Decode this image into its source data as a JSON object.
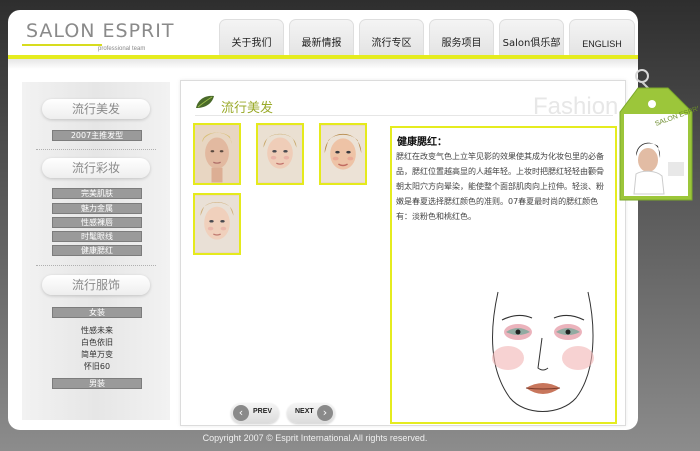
{
  "header": {
    "logo_text": "SALON ESPRIT",
    "logo_sub": "professional team",
    "nav": [
      {
        "label": "关于我们"
      },
      {
        "label": "最新情报"
      },
      {
        "label": "流行专区"
      },
      {
        "label": "服务项目"
      },
      {
        "label": "Salon俱乐部"
      },
      {
        "label": "ENGLISH"
      }
    ]
  },
  "sidebar": {
    "sections": [
      {
        "title": "流行美发",
        "items": [
          {
            "label": "2007主推发型",
            "style": "button"
          }
        ]
      },
      {
        "title": "流行彩妆",
        "items": [
          {
            "label": "完美肌肤",
            "style": "button"
          },
          {
            "label": "魅力金属",
            "style": "button"
          },
          {
            "label": "性感裸唇",
            "style": "button"
          },
          {
            "label": "时髦眼线",
            "style": "button"
          },
          {
            "label": "健康腮红",
            "style": "button"
          }
        ]
      },
      {
        "title": "流行服饰",
        "items": [
          {
            "label": "女装",
            "style": "button"
          },
          {
            "label": "性感未来",
            "style": "text"
          },
          {
            "label": "白色依旧",
            "style": "text"
          },
          {
            "label": "简单万变",
            "style": "text"
          },
          {
            "label": "怀旧60",
            "style": "text"
          },
          {
            "label": "男装",
            "style": "button"
          }
        ]
      }
    ]
  },
  "main": {
    "title": "流行美发",
    "watermark": "Fashion",
    "detail": {
      "title": "健康腮红：",
      "body": "腮红在改变气色上立竿见影的效果使其成为化妆包里的必备品，腮红位置越高显的人越年轻。上妆时把腮红轻轻由颧骨朝太阳穴方向晕染，能使整个面部肌肉向上拉伸。轻淡、粉嫩是春夏选择腮红颜色的准则。07春夏最时尚的腮红颜色有：淡粉色和桃红色。"
    },
    "pager": {
      "prev": "PREV",
      "next": "NEXT"
    }
  },
  "tag": {
    "brand": "SALON ESPRIT"
  },
  "footer": {
    "copyright": "Copyright 2007 © Esprit International.All rights reserved."
  },
  "colors": {
    "accent": "#e5ec1f",
    "title_green": "#9aaa2a",
    "tag_green": "#9cc63a"
  }
}
